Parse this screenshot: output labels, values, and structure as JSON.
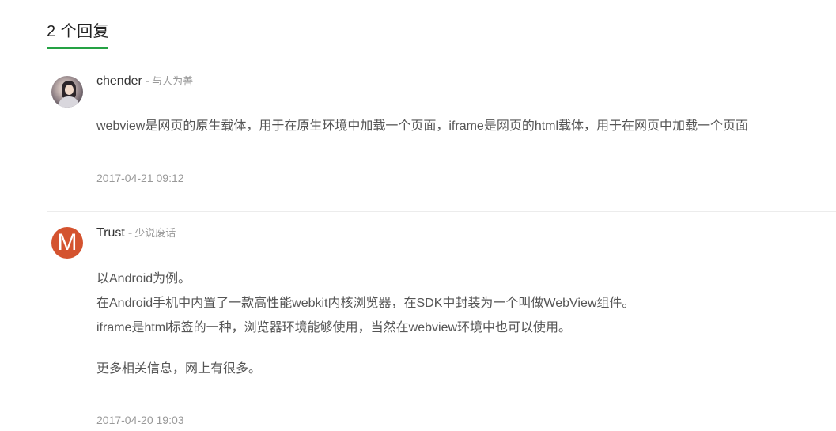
{
  "header": {
    "title": "2 个回复"
  },
  "answers": [
    {
      "author": "chender",
      "separator": "-",
      "signature": "与人为善",
      "avatar_icon": "user-photo-avatar",
      "content": [
        "webview是网页的原生载体，用于在原生环境中加载一个页面，iframe是网页的html载体，用于在网页中加载一个页面"
      ],
      "timestamp": "2017-04-21 09:12"
    },
    {
      "author": "Trust",
      "separator": "-",
      "signature": "少说废话",
      "avatar_icon": "letter-avatar",
      "avatar_letter": "M",
      "avatar_color": "#d4532f",
      "content": [
        "以Android为例。",
        "在Android手机中内置了一款高性能webkit内核浏览器，在SDK中封装为一个叫做WebView组件。",
        "iframe是html标签的一种，浏览器环境能够使用，当然在webview环境中也可以使用。",
        "更多相关信息，网上有很多。"
      ],
      "timestamp": "2017-04-20 19:03"
    }
  ],
  "colors": {
    "accent": "#25a244",
    "divider": "#ececec"
  }
}
